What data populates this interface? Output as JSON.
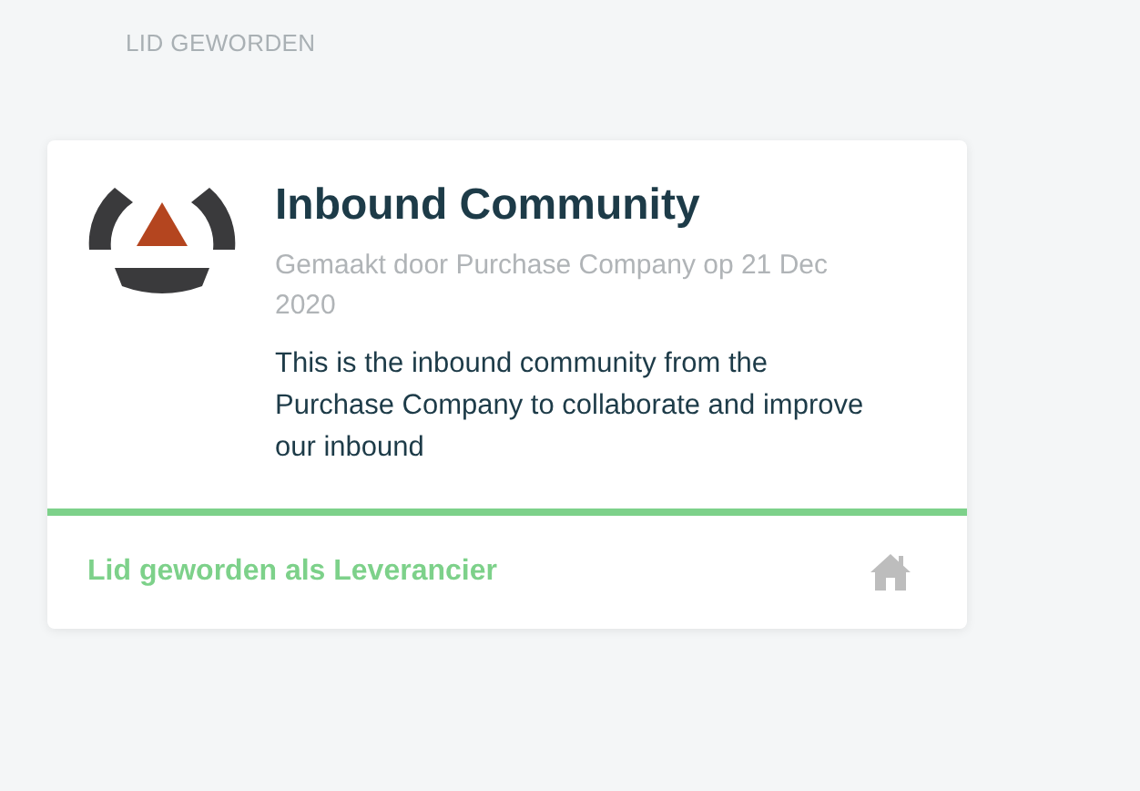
{
  "section_label": "LID GEWORDEN",
  "card": {
    "title": "Inbound Community",
    "subtitle": "Gemaakt door Purchase Company op 21 Dec 2020",
    "description": "This is the inbound community from the Purchase Company to collaborate and improve our inbound",
    "footer_label": "Lid geworden als Leverancier"
  }
}
